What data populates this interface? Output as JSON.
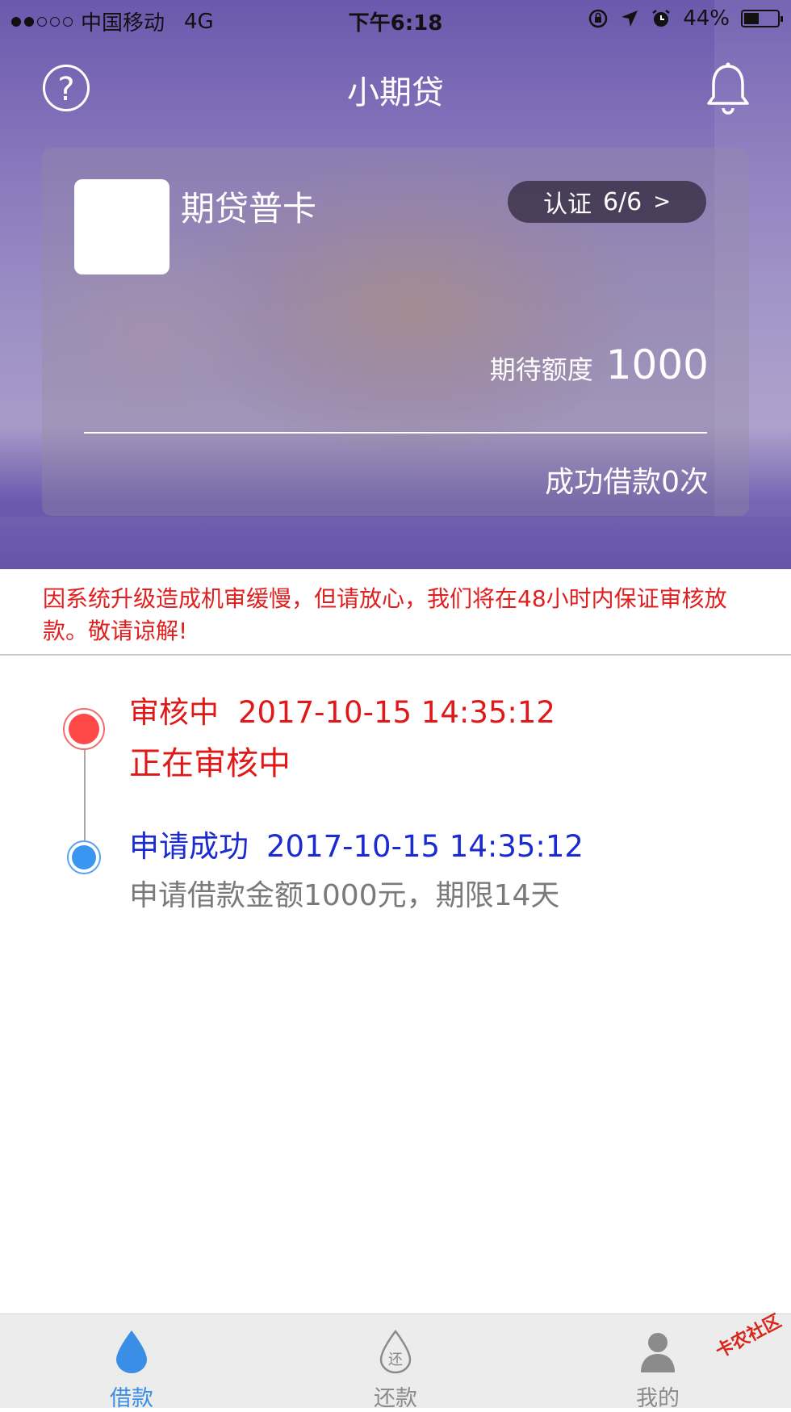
{
  "status_bar": {
    "carrier": "中国移动",
    "network": "4G",
    "time": "下午6:18",
    "battery": "44%"
  },
  "nav": {
    "title": "小期贷"
  },
  "card": {
    "name": "期贷普卡",
    "auth_label": "认证",
    "auth_progress": "6/6",
    "auth_arrow": ">",
    "limit_label": "期待额度",
    "limit_value": "1000",
    "success_count": "成功借款0次"
  },
  "notice": "因系统升级造成机审缓慢，但请放心，我们将在48小时内保证审核放款。敬请谅解!",
  "timeline": [
    {
      "status": "审核中",
      "time": "2017-10-15 14:35:12",
      "desc": "正在审核中",
      "color": "#e01818"
    },
    {
      "status": "申请成功",
      "time": "2017-10-15 14:35:12",
      "desc": "申请借款金额1000元，期限14天",
      "color": "#1b2bd0"
    }
  ],
  "tabs": [
    {
      "label": "借款",
      "icon": "drop-icon",
      "active": true
    },
    {
      "label": "还款",
      "icon": "repay-drop-icon",
      "active": false
    },
    {
      "label": "我的",
      "icon": "person-icon",
      "active": false
    }
  ],
  "watermark": "卡农社区",
  "colors": {
    "accent": "#3a8ee6",
    "alert": "#e01818",
    "header": "#6a59ad"
  }
}
